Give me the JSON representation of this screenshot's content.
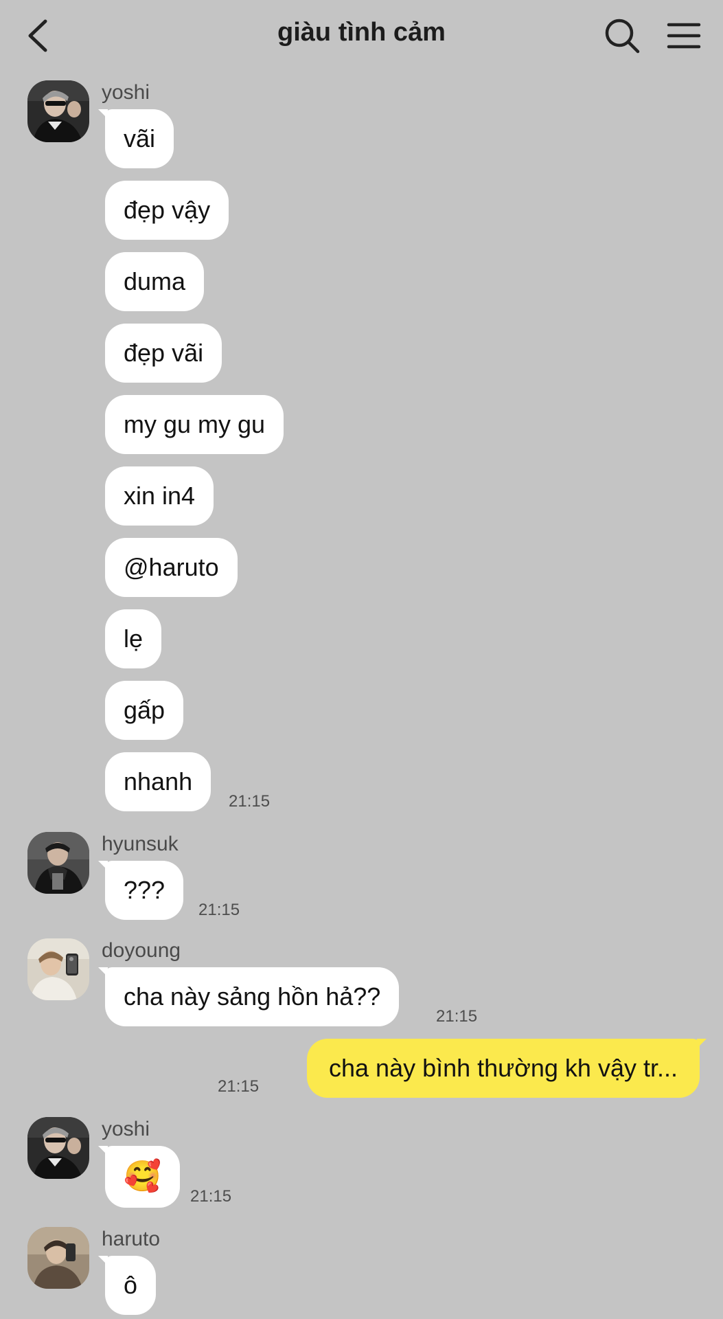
{
  "header": {
    "title": "giàu tình cảm",
    "back_icon": "chevron-left-icon",
    "search_icon": "search-icon",
    "menu_icon": "menu-icon"
  },
  "messages": [
    {
      "sender": "yoshi",
      "avatar": "avatar-yoshi",
      "texts": [
        "vãi",
        "đẹp vậy",
        "duma",
        "đẹp vãi",
        "my gu my gu",
        "xin in4",
        "@haruto",
        "lẹ",
        "gấp",
        "nhanh"
      ],
      "time": "21:15"
    },
    {
      "sender": "hyunsuk",
      "avatar": "avatar-hyunsuk",
      "texts": [
        "???"
      ],
      "time": "21:15"
    },
    {
      "sender": "doyoung",
      "avatar": "avatar-doyoung",
      "texts": [
        "cha này sảng hồn hả??"
      ],
      "time": "21:15"
    },
    {
      "sender": "me",
      "texts": [
        "cha này bình thường kh vậy tr..."
      ],
      "time": "21:15"
    },
    {
      "sender": "yoshi",
      "avatar": "avatar-yoshi",
      "texts": [
        "🥰"
      ],
      "time": "21:15"
    },
    {
      "sender": "haruto",
      "avatar": "avatar-haruto",
      "texts": [
        "ô"
      ],
      "time": ""
    }
  ],
  "colors": {
    "background": "#c4c4c4",
    "incoming_bubble": "#ffffff",
    "outgoing_bubble": "#fbe94d"
  }
}
